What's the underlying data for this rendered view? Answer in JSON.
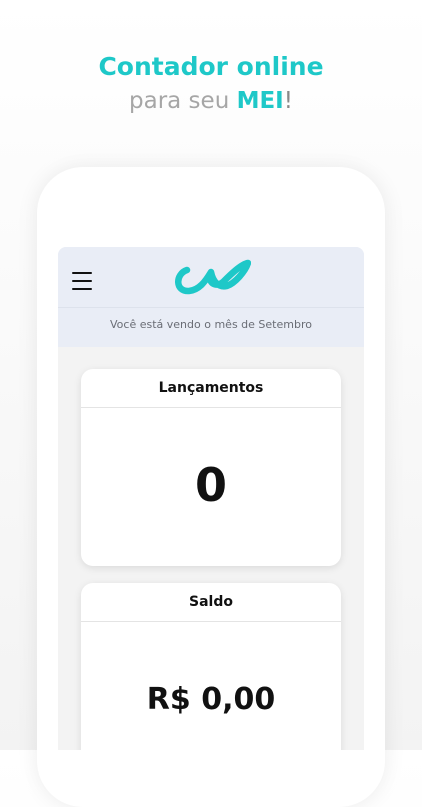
{
  "promo": {
    "headline": "Contador online",
    "subline_prefix": "para seu ",
    "subline_accent": "MEI",
    "subline_suffix": "!"
  },
  "header": {
    "menu_icon": "hamburger-menu-icon",
    "logo": "brand-logo-icon",
    "month_text": "Você está vendo o mês de Setembro"
  },
  "cards": [
    {
      "title": "Lançamentos",
      "value": "0"
    },
    {
      "title": "Saldo",
      "value": "R$ 0,00"
    }
  ],
  "colors": {
    "accent": "#1ec8c8",
    "header_bg": "#e9edf6",
    "text_dark": "#111111",
    "text_muted": "#a6a6a6"
  }
}
